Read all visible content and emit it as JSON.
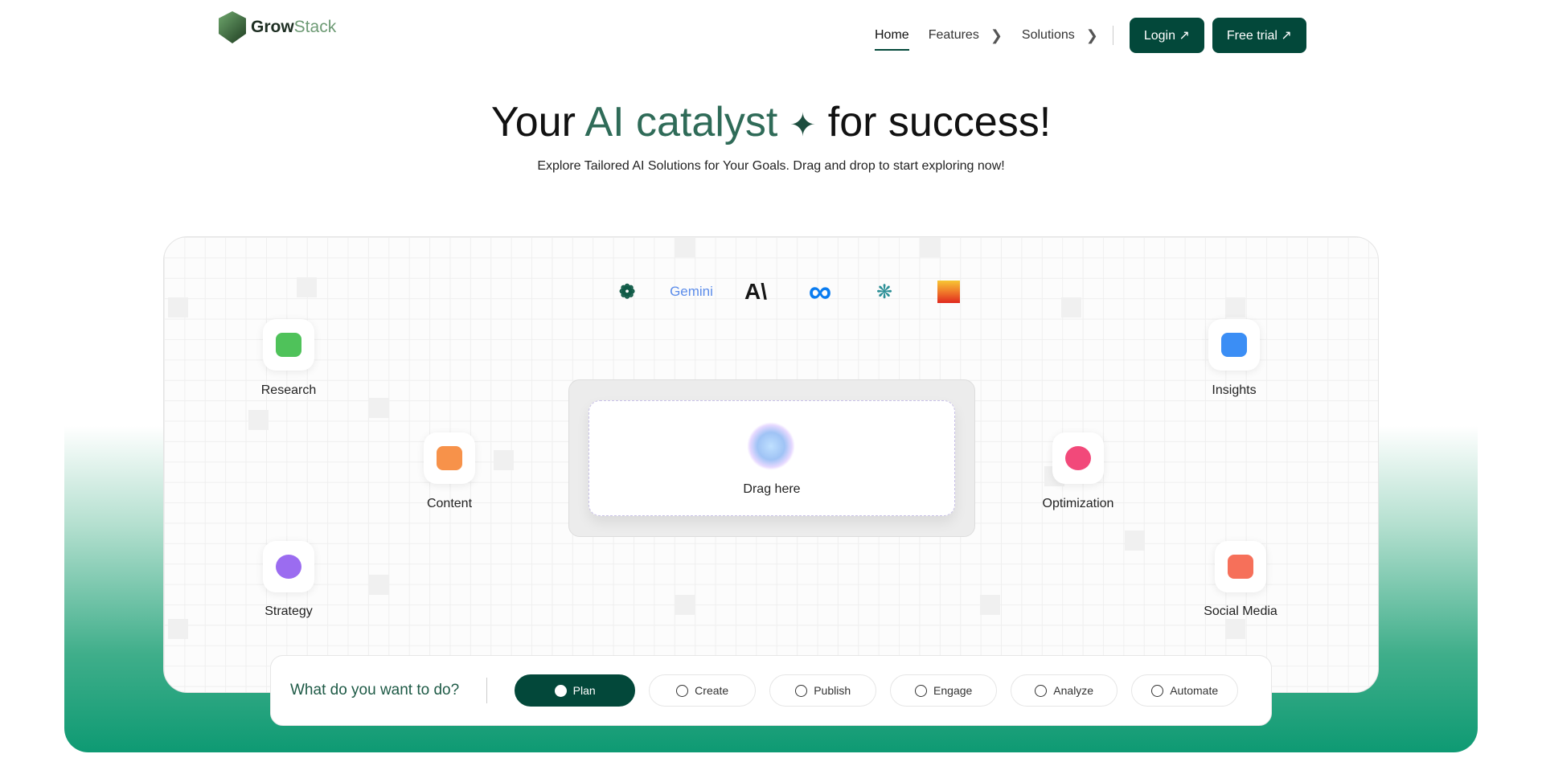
{
  "brand": {
    "name_bold": "Grow",
    "name_light": "Stack"
  },
  "nav": {
    "items": [
      {
        "label": "Home",
        "active": true
      },
      {
        "label": "Features",
        "chevron": true
      },
      {
        "label": "Solutions",
        "chevron": true
      }
    ],
    "login": "Login ↗",
    "trial": "Free trial ↗"
  },
  "hero": {
    "title_pre": "Your ",
    "title_accent": "AI catalyst",
    "title_icon": "sparkles-icon",
    "title_post": " for success!",
    "subtitle": "Explore Tailored AI Solutions for Your Goals. Drag and drop to start exploring now!"
  },
  "models": [
    "openai-icon",
    "gemini-icon",
    "anthropic-icon",
    "meta-icon",
    "perplexity-icon",
    "mistral-icon"
  ],
  "models_text": {
    "gemini": "Gemini",
    "anthropic": "A\\"
  },
  "drop": {
    "label": "Drag here"
  },
  "tools": [
    {
      "label": "Research",
      "color": "#4fc25a"
    },
    {
      "label": "Content",
      "color": "#f7924a"
    },
    {
      "label": "Strategy",
      "color": "#9b6cf0"
    },
    {
      "label": "Insights",
      "color": "#3b8ef5"
    },
    {
      "label": "Optimization",
      "color": "#f2497a"
    },
    {
      "label": "Social Media",
      "color": "#f6705a"
    }
  ],
  "actions": {
    "question": "What do you want to do?",
    "options": [
      {
        "label": "Plan",
        "selected": true
      },
      {
        "label": "Create"
      },
      {
        "label": "Publish"
      },
      {
        "label": "Engage"
      },
      {
        "label": "Analyze"
      },
      {
        "label": "Automate"
      }
    ]
  },
  "colors": {
    "brand": "#03483a",
    "accent": "#2f6b58",
    "band": "#0e9a73"
  }
}
